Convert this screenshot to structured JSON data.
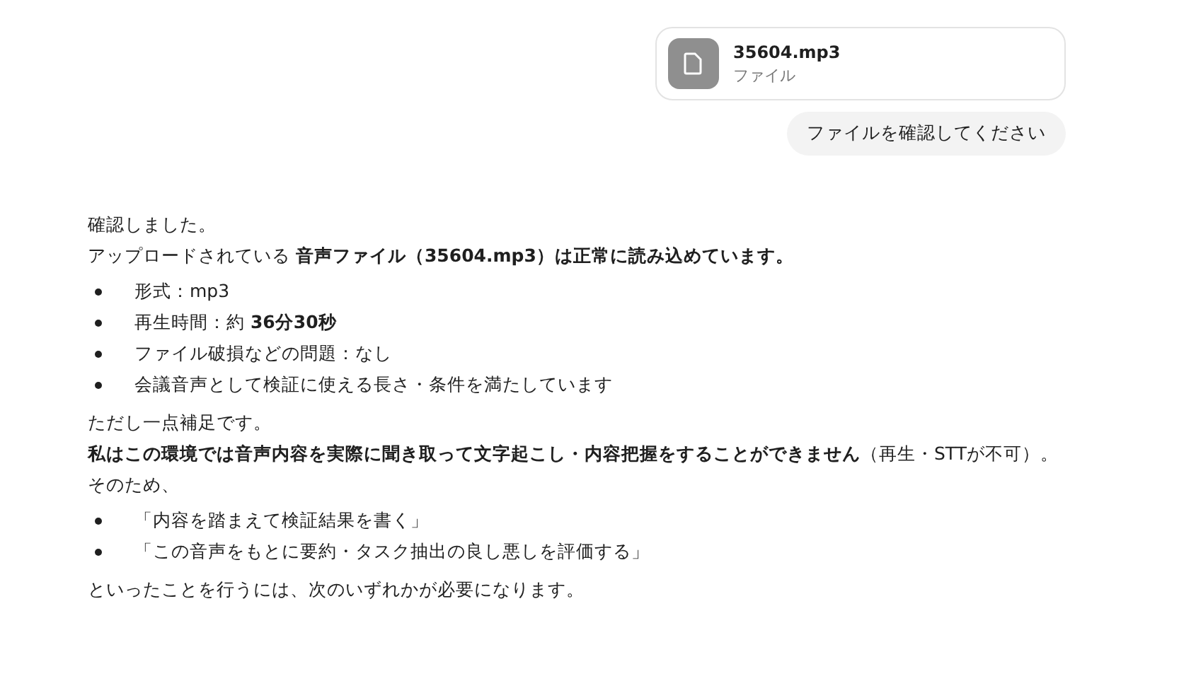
{
  "user_message": {
    "attachment": {
      "filename": "35604.mp3",
      "type_label": "ファイル"
    },
    "text": "ファイルを確認してください"
  },
  "assistant_message": [
    {
      "kind": "paragraph",
      "lines": [
        "確認しました。",
        "アップロードされている **音声ファイル（35604.mp3）は正常に読み込めています。**"
      ]
    },
    {
      "kind": "list",
      "items": [
        "形式：mp3",
        "再生時間：約 **36分30秒**",
        "ファイル破損などの問題：なし",
        "会議音声として検証に使える長さ・条件を満たしています"
      ]
    },
    {
      "kind": "paragraph",
      "lines": [
        "ただし一点補足です。",
        "**私はこの環境では音声内容を実際に聞き取って文字起こし・内容把握をすることができません**（再生・STTが不可）。",
        "そのため、"
      ]
    },
    {
      "kind": "list",
      "items": [
        "「内容を踏まえて検証結果を書く」",
        "「この音声をもとに要約・タスク抽出の良し悪しを評価する」"
      ]
    },
    {
      "kind": "paragraph",
      "lines": [
        "といったことを行うには、次のいずれかが必要になります。"
      ]
    }
  ]
}
